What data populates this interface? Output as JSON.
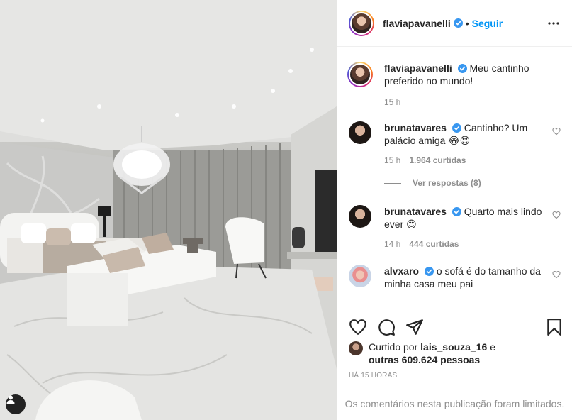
{
  "post": {
    "author": "flaviapavanelli",
    "follow_label": "Seguir",
    "separator": "•"
  },
  "caption": {
    "username": "flaviapavanelli",
    "text": "Meu cantinho preferido no mundo!",
    "time": "15 h"
  },
  "comments": [
    {
      "username": "brunatavares",
      "text": "Cantinho? Um palácio amiga 😂😍",
      "time": "15 h",
      "likes": "1.964 curtidas",
      "view_replies": "Ver respostas (8)"
    },
    {
      "username": "brunatavares",
      "text": "Quarto mais lindo ever 😍",
      "time": "14 h",
      "likes": "444 curtidas"
    },
    {
      "username": "alvxaro",
      "text": "o sofá é do tamanho da minha casa meu pai"
    }
  ],
  "liked_by": {
    "prefix": "Curtido por",
    "user": "lais_souza_16",
    "connector": "e",
    "others": "outras 609.624 pessoas"
  },
  "timestamp": "HÁ 15 HORAS",
  "comments_limited": "Os comentários nesta publicação foram limitados.",
  "icons": {
    "verified": "verified-badge-icon",
    "more": "more-options-icon",
    "like": "heart-icon",
    "comment": "comment-icon",
    "share": "share-icon",
    "save": "bookmark-icon",
    "user_tag": "user-tag-icon"
  },
  "colors": {
    "accent": "#0095f6",
    "muted": "#8e8e8e",
    "text": "#262626",
    "border": "#efefef"
  }
}
